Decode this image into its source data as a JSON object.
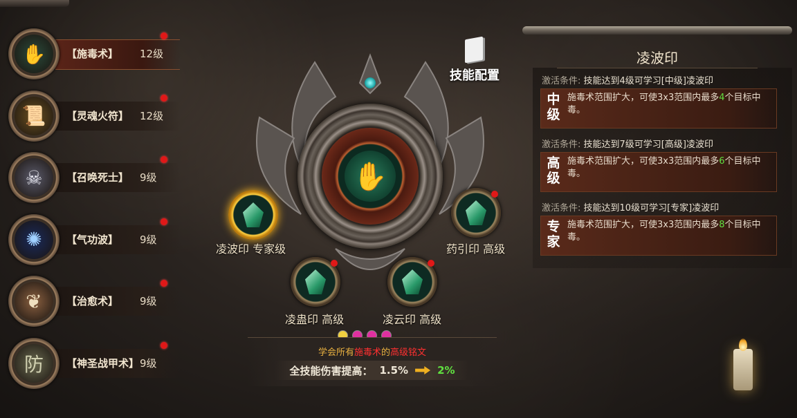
{
  "skills": [
    {
      "name": "【施毒术】",
      "level": "12级",
      "icon": "poison-hand-icon",
      "glyph": "✋",
      "color": "#7fd0a8",
      "bg": "#2a4a3a",
      "active": true
    },
    {
      "name": "【灵魂火符】",
      "level": "12级",
      "icon": "talisman-icon",
      "glyph": "📜",
      "color": "#f0d080",
      "bg": "#6a5020",
      "active": false
    },
    {
      "name": "【召唤死士】",
      "level": "9级",
      "icon": "skeleton-icon",
      "glyph": "☠",
      "color": "#e8e8f0",
      "bg": "#5a5a6a",
      "active": false
    },
    {
      "name": "【气功波】",
      "level": "9级",
      "icon": "energy-wave-icon",
      "glyph": "✺",
      "color": "#a0d0ff",
      "bg": "#1a2a5a",
      "active": false
    },
    {
      "name": "【治愈术】",
      "level": "9级",
      "icon": "heal-leaf-icon",
      "glyph": "❦",
      "color": "#f0e0c0",
      "bg": "#8a6040",
      "active": false
    },
    {
      "name": "【神圣战甲术】",
      "level": "9级",
      "icon": "shield-armor-icon",
      "glyph": "防",
      "color": "#d0d0b0",
      "bg": "#6a6a50",
      "active": false
    }
  ],
  "config": {
    "label": "技能配置"
  },
  "nodes": [
    {
      "label": "凌波印 专家级",
      "gold": true,
      "dot": false
    },
    {
      "label": "药引印 高级",
      "gold": false,
      "dot": true
    },
    {
      "label": "凌蛊印 高级",
      "gold": false,
      "dot": true
    },
    {
      "label": "凌云印 高级",
      "gold": false,
      "dot": true
    }
  ],
  "pips": [
    "#f0d040",
    "#e030a0",
    "#e030a0",
    "#e030a0"
  ],
  "learn": {
    "prefix": "学会所有",
    "skill": "施毒术",
    "mid": "的",
    "suffix": "高级铭文"
  },
  "damage": {
    "label": "全技能伤害提高：",
    "from": "1.5%",
    "to": "2%"
  },
  "panel": {
    "title": "凌波印",
    "tiers": [
      {
        "cond_key": "激活条件:",
        "cond": "技能达到4级可学习[中级]凌波印",
        "badge": "中级",
        "desc_pre": "施毒术范围扩大，可使3x3范围内最多",
        "num": "4",
        "desc_post": "个目标中毒。"
      },
      {
        "cond_key": "激活条件:",
        "cond": "技能达到7级可学习[高级]凌波印",
        "badge": "高级",
        "desc_pre": "施毒术范围扩大，可使3x3范围内最多",
        "num": "6",
        "desc_post": "个目标中毒。"
      },
      {
        "cond_key": "激活条件:",
        "cond": "技能达到10级可学习[专家]凌波印",
        "badge": "专家",
        "desc_pre": "施毒术范围扩大，可使3x3范围内最多",
        "num": "8",
        "desc_post": "个目标中毒。"
      }
    ]
  }
}
